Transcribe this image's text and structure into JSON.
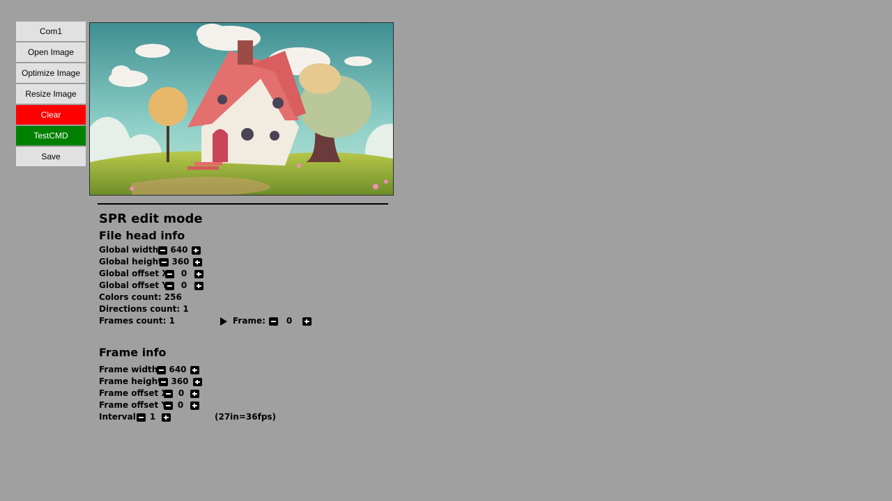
{
  "sidebar": {
    "buttons": [
      {
        "label": "Com1"
      },
      {
        "label": "Open Image"
      },
      {
        "label": "Optimize Image"
      },
      {
        "label": "Resize Image"
      },
      {
        "label": "Clear"
      },
      {
        "label": "TestCMD"
      },
      {
        "label": "Save"
      }
    ],
    "colors": {
      "default_bg": "#e1e1e1",
      "clear_bg": "#ff0000",
      "testcmd_bg": "#008000"
    }
  },
  "preview": {
    "description_icon": "image-preview"
  },
  "panel": {
    "title": "SPR edit mode",
    "file_head": {
      "heading": "File head info",
      "global_width_label": "Global width:",
      "global_width": "640",
      "global_height_label": "Global height:",
      "global_height": "360",
      "global_offset_x_label": "Global offset X:",
      "global_offset_x": "0",
      "global_offset_y_label": "Global offset Y:",
      "global_offset_y": "0",
      "colors_count": "Colors count: 256",
      "directions_count": "Directions count: 1",
      "frames_count": "Frames count: 1",
      "frame_label": "Frame:",
      "frame_value": "0"
    },
    "frame_info": {
      "heading": "Frame info",
      "frame_width_label": "Frame width:",
      "frame_width": "640",
      "frame_height_label": "Frame height:",
      "frame_height": "360",
      "frame_offset_x_label": "Frame offset X:",
      "frame_offset_x": "0",
      "frame_offset_y_label": "Frame offset Y:",
      "frame_offset_y": "0",
      "interval_label": "Interval:",
      "interval": "1",
      "interval_note": "(27in=36fps)"
    }
  }
}
